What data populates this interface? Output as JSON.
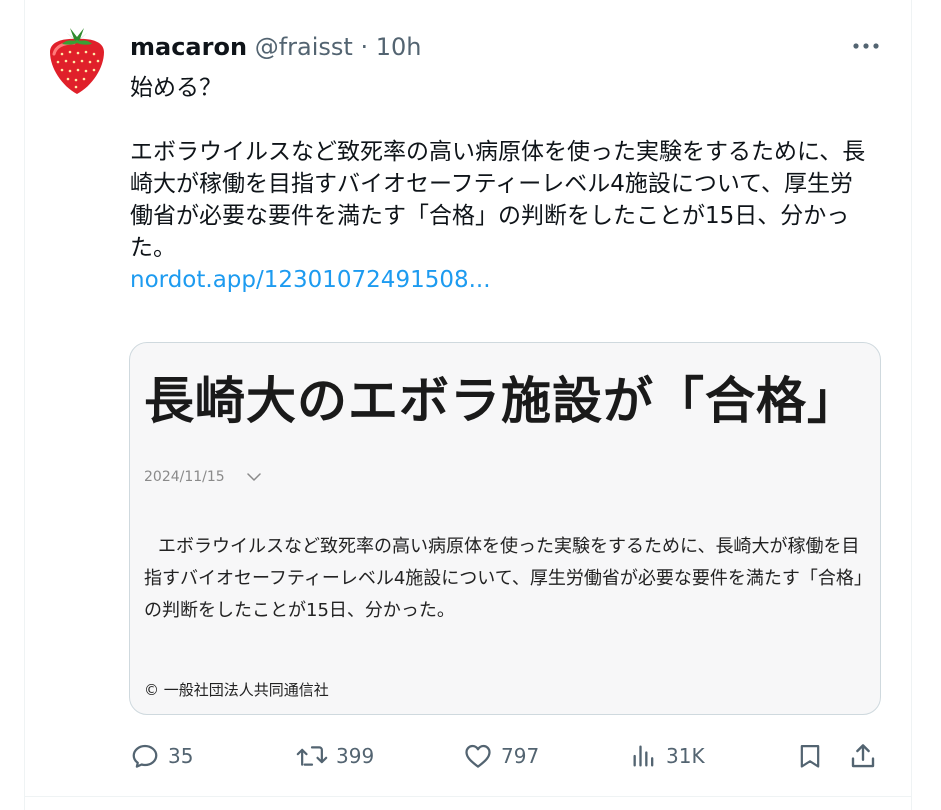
{
  "tweet": {
    "display_name": "macaron",
    "handle": "@fraisst",
    "separator": "·",
    "time": "10h",
    "text_line1": "始める？",
    "text_para": "エボラウイルスなど致死率の高い病原体を使った実験をするために、長崎大が稼働を目指すバイオセーフティーレベル4施設について、厚生労働省が必要な要件を満たす「合格」の判断をしたことが15日、分かった。",
    "link": "nordot.app/12301072491508..."
  },
  "card": {
    "title": "長崎大のエボラ施設が「合格」",
    "date": "2024/11/15",
    "body": "エボラウイルスなど致死率の高い病原体を使った実験をするために、長崎大が稼働を目指すバイオセーフティーレベル4施設について、厚生労働省が必要な要件を満たす「合格」の判断をしたことが15日、分かった。",
    "credit": "© 一般社団法人共同通信社"
  },
  "actions": {
    "replies": "35",
    "reposts": "399",
    "likes": "797",
    "views": "31K"
  },
  "icons": {
    "avatar": "strawberry-avatar",
    "more": "more-icon",
    "reply": "reply-icon",
    "repost": "repost-icon",
    "like": "heart-icon",
    "views": "views-icon",
    "bookmark": "bookmark-icon",
    "share": "share-icon",
    "date_toggle": "chevron-down-icon"
  },
  "colors": {
    "link": "#1d9bf0",
    "secondary_text": "#536471",
    "strawberry": "#e0202a"
  }
}
